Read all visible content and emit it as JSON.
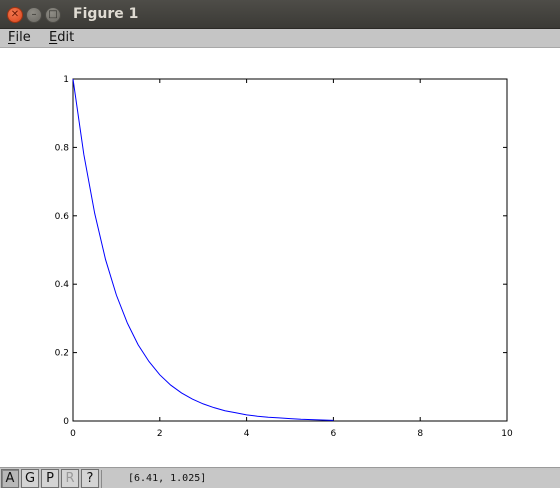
{
  "window": {
    "title": "Figure 1"
  },
  "menu": {
    "items": [
      {
        "mnemonic": "F",
        "rest": "ile"
      },
      {
        "mnemonic": "E",
        "rest": "dit"
      }
    ]
  },
  "toolbar": {
    "buttons": [
      "A",
      "G",
      "P",
      "R",
      "?"
    ],
    "active": "A",
    "disabled": "R"
  },
  "status": {
    "coordinates": "[6.41, 1.025]"
  },
  "colors": {
    "line": "#0000ff"
  },
  "chart_data": {
    "type": "line",
    "title": "",
    "xlabel": "",
    "ylabel": "",
    "xlim": [
      0,
      10
    ],
    "ylim": [
      0,
      1
    ],
    "xticks": [
      "0",
      "2",
      "4",
      "6",
      "8",
      "10"
    ],
    "yticks": [
      "0",
      "0.2",
      "0.4",
      "0.6",
      "0.8",
      "1"
    ],
    "grid": false,
    "series": [
      {
        "x": [
          0,
          0.25,
          0.5,
          0.75,
          1,
          1.25,
          1.5,
          1.75,
          2,
          2.25,
          2.5,
          2.75,
          3,
          3.25,
          3.5,
          3.75,
          4,
          4.25,
          4.5,
          4.75,
          5,
          5.25,
          5.5,
          5.75,
          6
        ],
        "y": [
          1,
          0.779,
          0.607,
          0.472,
          0.368,
          0.287,
          0.223,
          0.174,
          0.135,
          0.105,
          0.082,
          0.064,
          0.05,
          0.039,
          0.03,
          0.024,
          0.018,
          0.014,
          0.011,
          0.009,
          0.007,
          0.005,
          0.004,
          0.003,
          0.002
        ]
      }
    ]
  }
}
